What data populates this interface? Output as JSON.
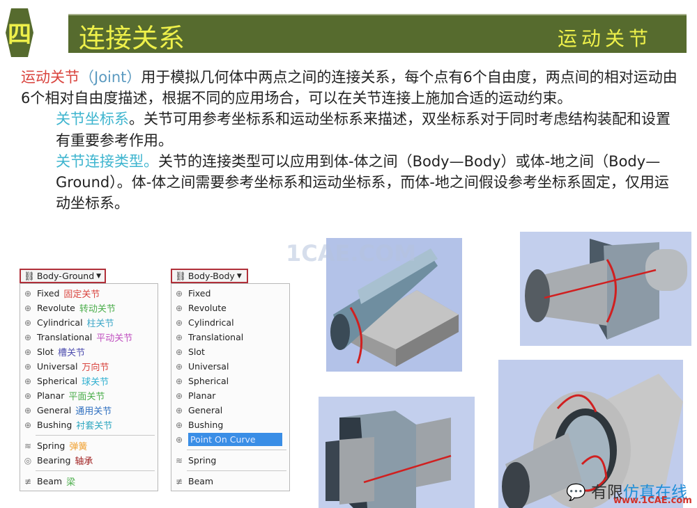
{
  "header": {
    "section_number": "四",
    "title": "连接关系",
    "subtitle": "运动关节"
  },
  "body": {
    "p1_term": "运动关节",
    "p1_joint": "（Joint）",
    "p1_text": "用于模拟几何体中两点之间的连接关系，每个点有6个自由度，两点间的相对运动由6个相对自由度描述，根据不同的应用场合，可以在关节连接上施加合适的运动约束。",
    "p2_term": "关节坐标系",
    "p2_text": "。关节可用参考坐标系和运动坐标系来描述，双坐标系对于同时考虑结构装配和设置有重要参考作用。",
    "p3_term": "关节连接类型。",
    "p3_text": "关节的连接类型可以应用到体-体之间（Body—Body）或体-地之间（Body—Ground）。体-体之间需要参考坐标系和运动坐标系，而体-地之间假设参考坐标系固定，仅用运动坐标系。"
  },
  "menu_ground": {
    "label": "Body-Ground",
    "items": [
      {
        "en": "Fixed",
        "cn": "固定关节",
        "color": "#d9443e"
      },
      {
        "en": "Revolute",
        "cn": "转动关节",
        "color": "#4cae4c"
      },
      {
        "en": "Cylindrical",
        "cn": "柱关节",
        "color": "#3fa8c8"
      },
      {
        "en": "Translational",
        "cn": "平动关节",
        "color": "#c050c0"
      },
      {
        "en": "Slot",
        "cn": "槽关节",
        "color": "#5050b0"
      },
      {
        "en": "Universal",
        "cn": "万向节",
        "color": "#d9443e"
      },
      {
        "en": "Spherical",
        "cn": "球关节",
        "color": "#30b0d0"
      },
      {
        "en": "Planar",
        "cn": "平面关节",
        "color": "#4cae4c"
      },
      {
        "en": "General",
        "cn": "通用关节",
        "color": "#3070c0"
      },
      {
        "en": "Bushing",
        "cn": "衬套关节",
        "color": "#30a8c0"
      },
      {
        "en": "Spring",
        "cn": "弹簧",
        "color": "#f0a030"
      },
      {
        "en": "Bearing",
        "cn": "轴承",
        "color": "#a02020"
      },
      {
        "en": "Beam",
        "cn": "梁",
        "color": "#4cae4c"
      }
    ]
  },
  "menu_body": {
    "label": "Body-Body",
    "items": [
      "Fixed",
      "Revolute",
      "Cylindrical",
      "Translational",
      "Slot",
      "Universal",
      "Spherical",
      "Planar",
      "General",
      "Bushing",
      "Point On Curve",
      "Spring",
      "Beam"
    ],
    "selected": "Point On Curve"
  },
  "watermarks": {
    "top": "1CAE.COM",
    "logo_a": "有限",
    "logo_b": "仿真在线",
    "url": "www.1CAE.com"
  }
}
